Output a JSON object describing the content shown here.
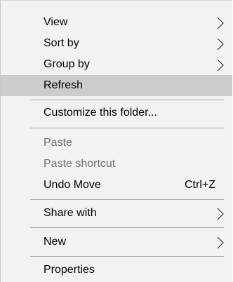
{
  "menu": {
    "items": [
      {
        "label": "View",
        "icon": "chevron-right-icon"
      },
      {
        "label": "Sort by",
        "icon": "chevron-right-icon"
      },
      {
        "label": "Group by",
        "icon": "chevron-right-icon"
      },
      {
        "label": "Refresh",
        "state": "highlighted"
      },
      {
        "label": "Customize this folder..."
      },
      {
        "label": "Paste",
        "state": "disabled"
      },
      {
        "label": "Paste shortcut",
        "state": "disabled"
      },
      {
        "label": "Undo Move",
        "shortcut": "Ctrl+Z"
      },
      {
        "label": "Share with",
        "icon": "chevron-right-icon"
      },
      {
        "label": "New",
        "icon": "chevron-right-icon"
      },
      {
        "label": "Properties"
      }
    ]
  },
  "colors": {
    "menu_background": "#f2f2f2",
    "highlight": "#cccccc",
    "disabled_text": "#6d6d6d",
    "separator": "#a9a9a9"
  }
}
